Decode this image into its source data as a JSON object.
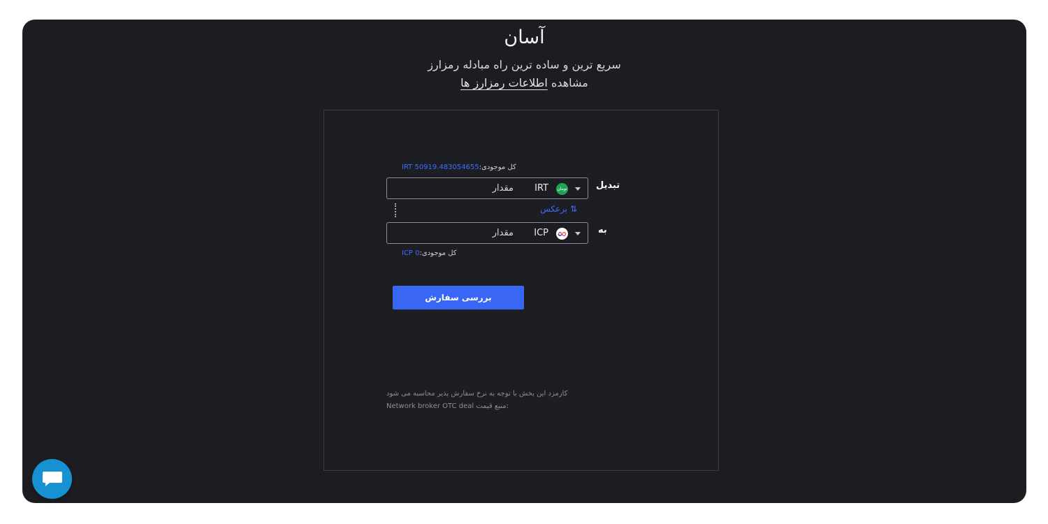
{
  "header": {
    "title": "آسان",
    "subtitle": "سریع ترین و ساده ترین راه مبادله رمزارز",
    "view_prefix": "مشاهده",
    "view_link": "اطلاعات رمزارز ها"
  },
  "form": {
    "from": {
      "label": "تبدیل",
      "balance_label": "کل موجودی:",
      "balance_value": "IRT 50919.483054655",
      "amount_placeholder": "مقدار",
      "symbol": "IRT",
      "icon_text": "تومان",
      "icon": "toman-coin-icon"
    },
    "swap_label": "برعکس",
    "swap_icon": "⇅",
    "to": {
      "label": "به",
      "balance_label": "کل موجودی:",
      "balance_value": "ICP 0",
      "amount_placeholder": "مقدار",
      "symbol": "ICP",
      "icon": "icp-coin-icon"
    },
    "submit_label": "بررسی سفارش",
    "fee_note": "کارمزد این بخش با توجه به نرخ سفارش پذیر محاسبه می شود",
    "price_source_label": "منبع قیمت:",
    "price_source_value": "Network broker OTC deal"
  },
  "colors": {
    "accent": "#3966f5",
    "link": "#3f6bff",
    "background": "#1c1c21",
    "chat": "#1692d3"
  },
  "chat_icon": "chat-bubble-icon"
}
